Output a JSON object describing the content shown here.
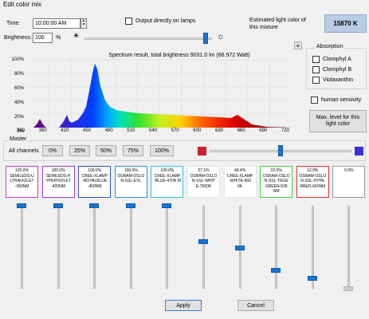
{
  "window": {
    "title": "Edit color mix"
  },
  "time": {
    "label": "Time:",
    "value": "10:00:00 AM"
  },
  "output_lamps": {
    "label": "Output directly on lamps"
  },
  "estimated": {
    "label": "Estimated light color of this mixture",
    "value": "15870 K"
  },
  "brightness": {
    "label": "Brightness:",
    "value": "100",
    "unit": "%",
    "level": 0.95
  },
  "plus_label": "+",
  "spectrum": {
    "title": "Spectrum result, total brightness 9031.0 lm (66.972 Watt)",
    "y_ticks": [
      "100%",
      "80%",
      "60%",
      "40%",
      "20%",
      "0%"
    ],
    "x_ticks": [
      "360",
      "390",
      "420",
      "450",
      "480",
      "510",
      "540",
      "570",
      "600",
      "630",
      "660",
      "690",
      "720"
    ]
  },
  "absorption": {
    "title": "Absorption",
    "items": [
      "Clorophyl A",
      "Clorophyl B",
      "Violaxanthin"
    ]
  },
  "human_sensitivity": {
    "label": "human sensivity"
  },
  "max_level_button": {
    "label": "Max. level for this light color"
  },
  "master": {
    "title": "Master",
    "all_channels_label": "All channels",
    "presets": [
      "0%",
      "25%",
      "50%",
      "75%",
      "100%"
    ],
    "level": 0.5,
    "color_start": "#d0202a",
    "color_end": "#3a30d0"
  },
  "channels": [
    {
      "pct": "100.0%",
      "name": "SEMILEDS-U LTRAVIOLET -380NM",
      "color": "#c040c0",
      "level": 1.0
    },
    {
      "pct": "100.0%",
      "name": "SEMILEDS-H YPERVIOLET -420NM",
      "color": "#9040d0",
      "level": 1.0
    },
    {
      "pct": "100.0%",
      "name": "CREE-XLAMP -ROYALBLUE -450NM",
      "color": "#3050d0",
      "level": 1.0
    },
    {
      "pct": "100.0%",
      "name": "OSRAM-OSLO N-SSL-EVL",
      "color": "#3090e0",
      "level": 1.0
    },
    {
      "pct": "100.0%",
      "name": "CREE-XLAMP -BLUE-470N M",
      "color": "#30c0e0",
      "level": 1.0
    },
    {
      "pct": "57.1%",
      "name": "OSRAM-OSLO N-SSL-WHIT E-7500K",
      "color": "#d8eaf0",
      "level": 0.571
    },
    {
      "pct": "49.4%",
      "name": "CREE-XLAMP -WHITE-650 0K",
      "color": "#e0e8f0",
      "level": 0.494
    },
    {
      "pct": "22.0%",
      "name": "OSRAM-OSLO N-SSL-TRUE GREEN-528 NM",
      "color": "#40d040",
      "level": 0.22
    },
    {
      "pct": "12.9%",
      "name": "OSRAM-OSLO N-SSL-HYPE RRED-660NM",
      "color": "#e03030",
      "level": 0.129
    },
    {
      "pct": "0.0%",
      "name": "",
      "color": "#999999",
      "level": 0.0
    }
  ],
  "buttons": {
    "apply": "Apply",
    "cancel": "Cancel"
  }
}
